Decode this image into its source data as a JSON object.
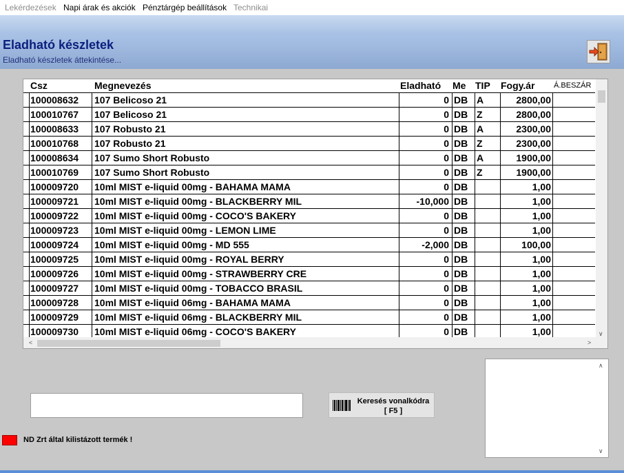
{
  "menu": [
    "Lekérdezések",
    "Napi árak és akciók",
    "Pénztárgép beállítások",
    "Technikai"
  ],
  "header": {
    "title": "Eladható készletek",
    "subtitle": "Eladható készletek áttekintése..."
  },
  "grid": {
    "columns": [
      "Csz",
      "Megnevezés",
      "Eladható",
      "Me",
      "TIP",
      "Fogy.ár",
      "Á.BESZÁR"
    ],
    "rows": [
      [
        "100008632",
        "107 Belicoso 21",
        "0",
        "DB",
        "A",
        "2800,00"
      ],
      [
        "100010767",
        "107 Belicoso 21",
        "0",
        "DB",
        "Z",
        "2800,00"
      ],
      [
        "100008633",
        "107 Robusto 21",
        "0",
        "DB",
        "A",
        "2300,00"
      ],
      [
        "100010768",
        "107 Robusto 21",
        "0",
        "DB",
        "Z",
        "2300,00"
      ],
      [
        "100008634",
        "107 Sumo Short Robusto",
        "0",
        "DB",
        "A",
        "1900,00"
      ],
      [
        "100010769",
        "107 Sumo Short Robusto",
        "0",
        "DB",
        "Z",
        "1900,00"
      ],
      [
        "100009720",
        "10ml MIST e-liquid 00mg - BAHAMA MAMA",
        "0",
        "DB",
        "",
        "1,00"
      ],
      [
        "100009721",
        "10ml MIST e-liquid 00mg - BLACKBERRY MIL",
        "-10,000",
        "DB",
        "",
        "1,00"
      ],
      [
        "100009722",
        "10ml MIST e-liquid 00mg - COCO'S BAKERY",
        "0",
        "DB",
        "",
        "1,00"
      ],
      [
        "100009723",
        "10ml MIST e-liquid 00mg - LEMON LIME",
        "0",
        "DB",
        "",
        "1,00"
      ],
      [
        "100009724",
        "10ml MIST e-liquid 00mg - MD 555",
        "-2,000",
        "DB",
        "",
        "100,00"
      ],
      [
        "100009725",
        "10ml MIST e-liquid 00mg - ROYAL BERRY",
        "0",
        "DB",
        "",
        "1,00"
      ],
      [
        "100009726",
        "10ml MIST e-liquid 00mg - STRAWBERRY CRE",
        "0",
        "DB",
        "",
        "1,00"
      ],
      [
        "100009727",
        "10ml MIST e-liquid 00mg - TOBACCO BRASIL",
        "0",
        "DB",
        "",
        "1,00"
      ],
      [
        "100009728",
        "10ml MIST e-liquid 06mg - BAHAMA MAMA",
        "0",
        "DB",
        "",
        "1,00"
      ],
      [
        "100009729",
        "10ml MIST e-liquid 06mg - BLACKBERRY MIL",
        "0",
        "DB",
        "",
        "1,00"
      ],
      [
        "100009730",
        "10ml MIST e-liquid 06mg - COCO'S BAKERY",
        "0",
        "DB",
        "",
        "1,00"
      ]
    ]
  },
  "search": {
    "value": "",
    "button_line1": "Keresés vonalkódra",
    "button_line2": "[ F5 ]"
  },
  "legend": {
    "color": "#ff0000",
    "text": "ND Zrt által kilistázott termék !"
  },
  "icons": {
    "exit": "exit-door-icon",
    "barcode": "barcode-icon"
  }
}
